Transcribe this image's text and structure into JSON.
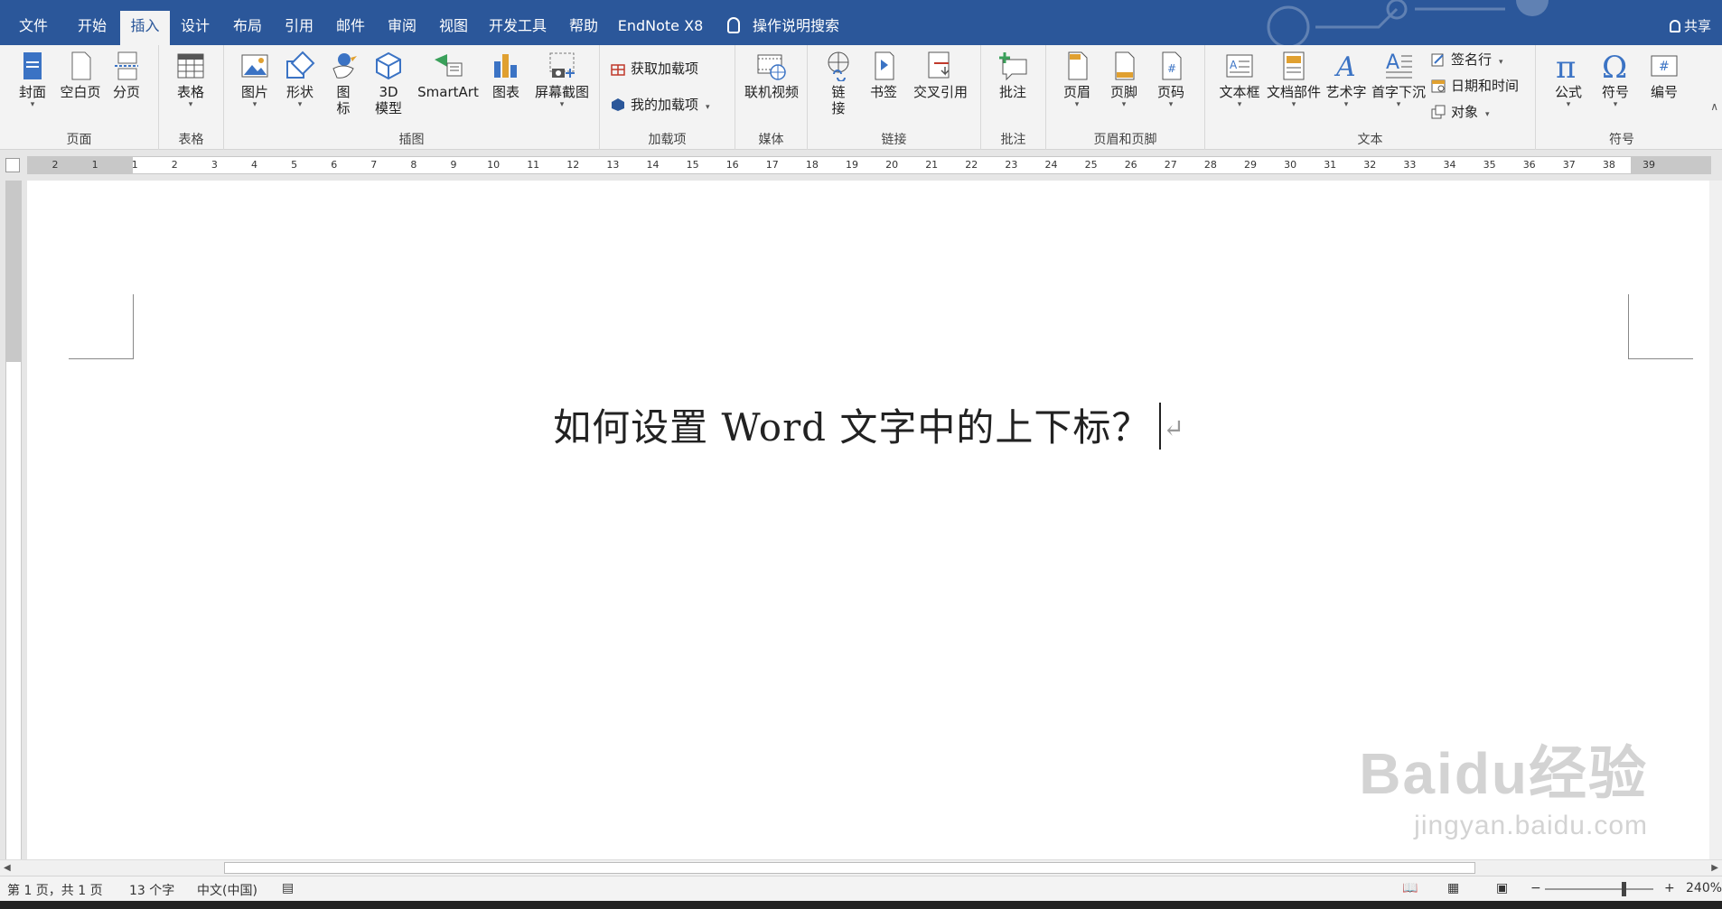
{
  "tabs": [
    {
      "label": "文件"
    },
    {
      "label": "开始"
    },
    {
      "label": "插入",
      "active": true
    },
    {
      "label": "设计"
    },
    {
      "label": "布局"
    },
    {
      "label": "引用"
    },
    {
      "label": "邮件"
    },
    {
      "label": "审阅"
    },
    {
      "label": "视图"
    },
    {
      "label": "开发工具"
    },
    {
      "label": "帮助"
    },
    {
      "label": "EndNote X8"
    }
  ],
  "tell_me": "操作说明搜索",
  "share": "共享",
  "ribbon": {
    "groups": {
      "pages": {
        "label": "页面",
        "buttons": {
          "cover": "封面",
          "blank": "空白页",
          "break": "分页"
        }
      },
      "tables": {
        "label": "表格",
        "buttons": {
          "table": "表格"
        }
      },
      "illustrations": {
        "label": "插图",
        "buttons": {
          "picture": "图片",
          "shapes": "形状",
          "icons_line1": "图",
          "icons_line2": "标",
          "model_line1": "3D",
          "model_line2": "模型",
          "smartart": "SmartArt",
          "chart": "图表",
          "screenshot": "屏幕截图"
        }
      },
      "addins": {
        "label": "加载项",
        "buttons": {
          "get": "获取加载项",
          "mine": "我的加载项"
        }
      },
      "media": {
        "label": "媒体",
        "buttons": {
          "video": "联机视频"
        }
      },
      "links": {
        "label": "链接",
        "buttons": {
          "link_line1": "链",
          "link_line2": "接",
          "bookmark": "书签",
          "crossref": "交叉引用"
        }
      },
      "comments": {
        "label": "批注",
        "buttons": {
          "comment": "批注"
        }
      },
      "header_footer": {
        "label": "页眉和页脚",
        "buttons": {
          "header": "页眉",
          "footer": "页脚",
          "pagenum": "页码"
        }
      },
      "text": {
        "label": "文本",
        "buttons": {
          "textbox": "文本框",
          "quickparts": "文档部件",
          "wordart": "艺术字",
          "dropcap": "首字下沉",
          "signature": "签名行",
          "datetime": "日期和时间",
          "object": "对象"
        }
      },
      "symbols": {
        "label": "符号",
        "buttons": {
          "equation": "公式",
          "symbol": "符号",
          "number": "编号"
        }
      }
    }
  },
  "ruler": {
    "numbers": [
      "2",
      "1",
      "1",
      "2",
      "3",
      "4",
      "5",
      "6",
      "7",
      "8",
      "9",
      "10",
      "11",
      "12",
      "13",
      "14",
      "15",
      "16",
      "17",
      "18",
      "19",
      "20",
      "21",
      "22",
      "23",
      "24",
      "25",
      "26",
      "27",
      "28",
      "29",
      "30",
      "31",
      "32",
      "33",
      "34",
      "35",
      "36",
      "37",
      "38",
      "39"
    ]
  },
  "document": {
    "title": "如何设置 Word 文字中的上下标？",
    "para_mark": "↵"
  },
  "watermark": {
    "logo": "Baidu经验",
    "url": "jingyan.baidu.com"
  },
  "status": {
    "page": "第 1 页，共 1 页",
    "words": "13 个字",
    "language": "中文(中国)",
    "zoom": "240%"
  },
  "colors": {
    "accent": "#2b579a",
    "ribbon_bg": "#f3f3f3",
    "page_bg": "#ffffff"
  }
}
